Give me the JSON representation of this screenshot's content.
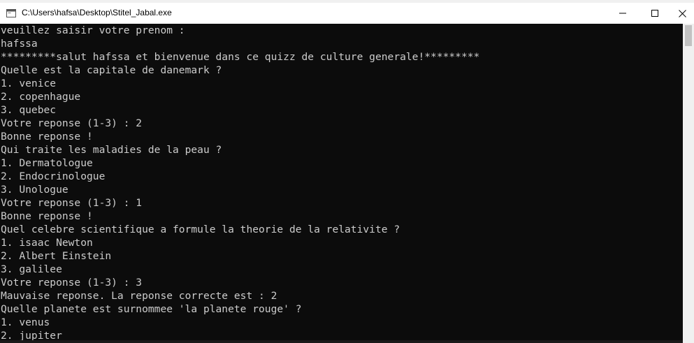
{
  "window": {
    "title": "C:\\Users\\hafsa\\Desktop\\Stitel_Jabal.exe",
    "icon": "console-app-icon",
    "controls": [
      "minimize-icon",
      "maximize-icon",
      "close-icon"
    ]
  },
  "console": {
    "background": "#0c0c0c",
    "foreground": "#cccccc",
    "lines": [
      "veuillez saisir votre prenom :",
      "hafssa",
      "*********salut hafssa et bienvenue dans ce quizz de culture generale!*********",
      "Quelle est la capitale de danemark ?",
      "1. venice",
      "2. copenhague",
      "3. quebec",
      "Votre reponse (1-3) : 2",
      "Bonne reponse !",
      "Qui traite les maladies de la peau ?",
      "1. Dermatologue",
      "2. Endocrinologue",
      "3. Unologue",
      "Votre reponse (1-3) : 1",
      "Bonne reponse !",
      "Quel celebre scientifique a formule la theorie de la relativite ?",
      "1. isaac Newton",
      "2. Albert Einstein",
      "3. galilee",
      "Votre reponse (1-3) : 3",
      "Mauvaise reponse. La reponse correcte est : 2",
      "Quelle planete est surnommee 'la planete rouge' ?",
      "1. venus",
      "2. jupiter"
    ]
  }
}
